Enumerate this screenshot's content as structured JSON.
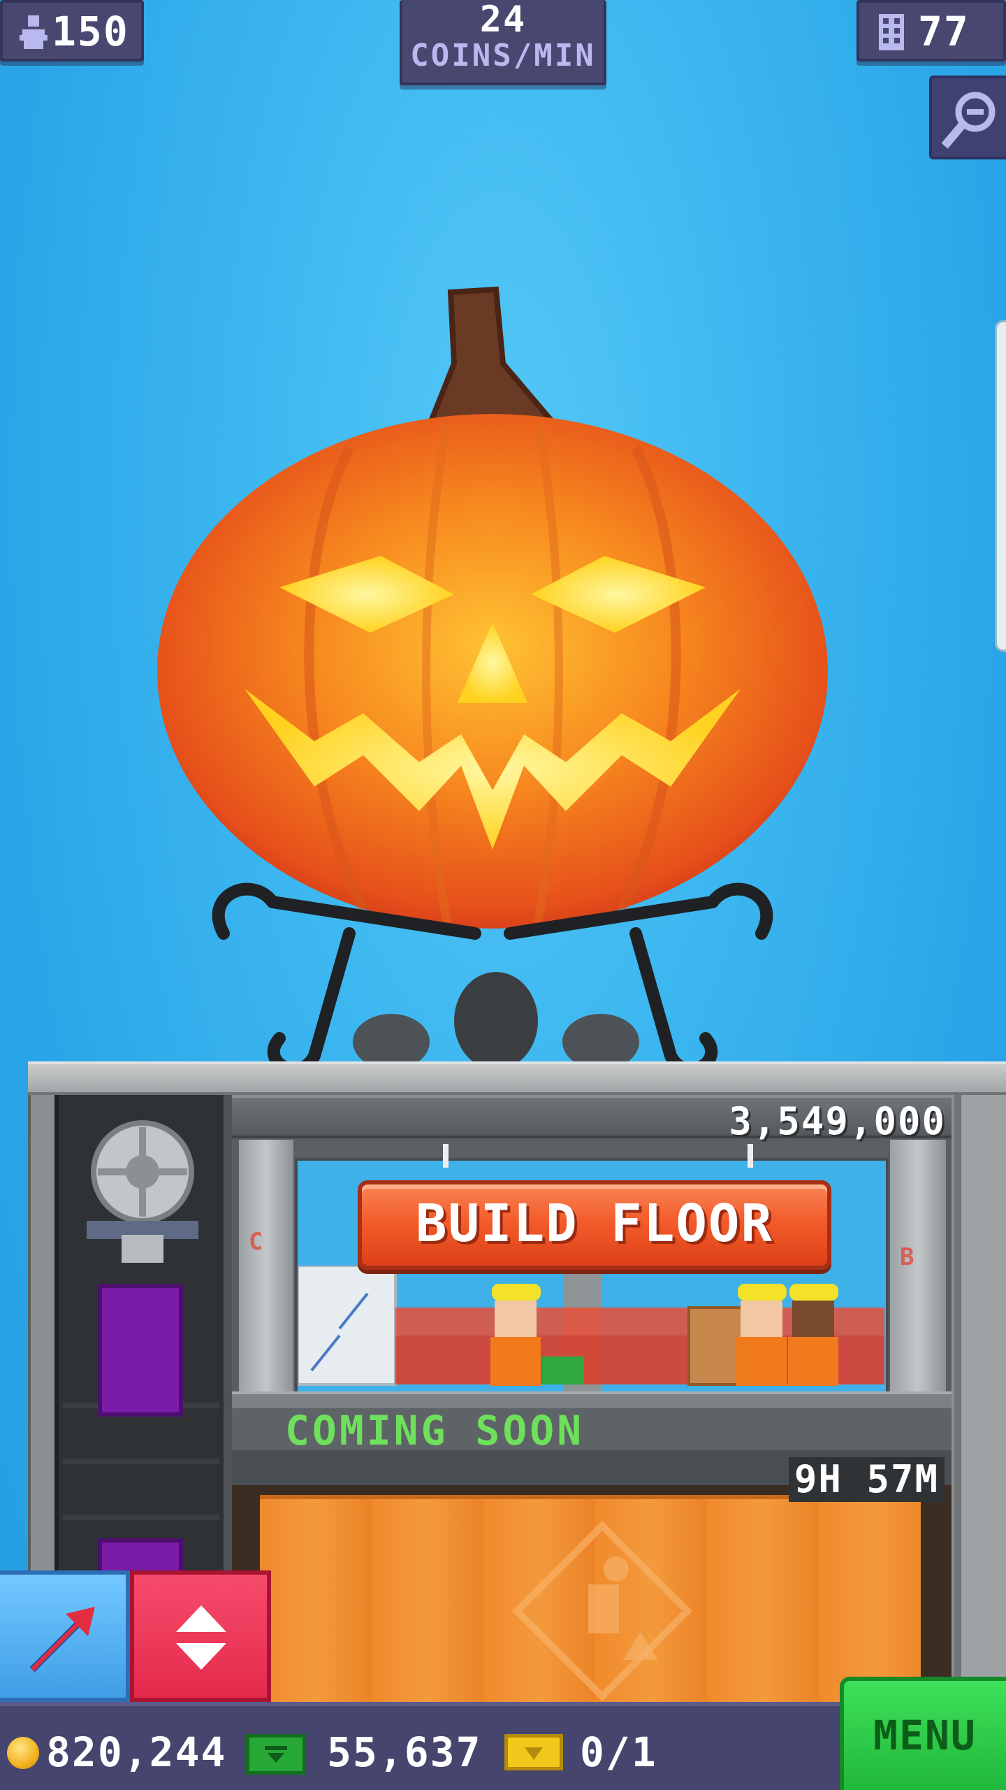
{
  "hud": {
    "population": "150",
    "coins_per_min_value": "24",
    "coins_per_min_label": "COINS/MIN",
    "floors": "77"
  },
  "icons": {
    "population": "person-icon",
    "floors": "building-icon",
    "zoom": "magnify-zoom-out-icon",
    "arrow": "diagonal-arrow-icon",
    "elevator": "up-down-arrows-icon",
    "coins": "coin-icon",
    "bux": "tower-bux-icon",
    "tickets": "golden-ticket-icon"
  },
  "tower": {
    "build_floor_cost": "3,549,000",
    "build_floor_label": "BUILD FLOOR",
    "floor_marker_left": "C",
    "floor_marker_right": "B",
    "coming_soon": "COMING SOON",
    "construction_timer": "9H 57M"
  },
  "currency": {
    "coins": "820,244",
    "bux": "55,637",
    "tickets": "0/1"
  },
  "menu_label": "MENU",
  "colors": {
    "sky": "#3db7f0",
    "hud_panel": "#474770",
    "build_button": "#f35c2b",
    "coming_soon_text": "#6fe05b",
    "menu_button": "#21b83b"
  }
}
